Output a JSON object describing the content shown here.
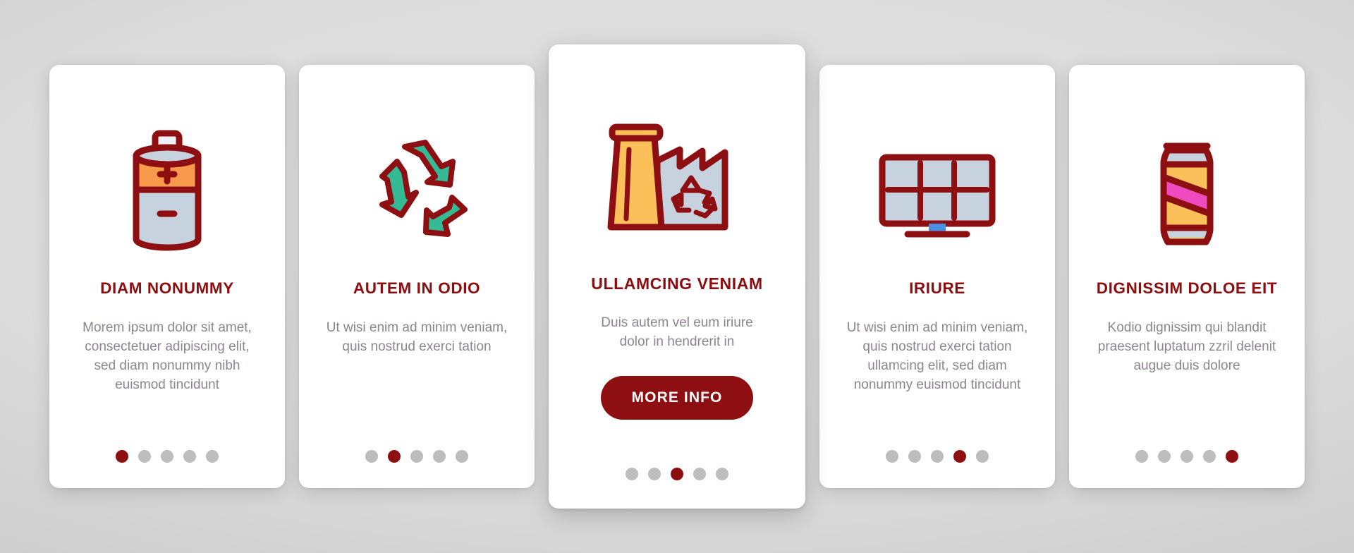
{
  "theme": {
    "background": "#dcdcdc",
    "card_background": "#ffffff",
    "accent_red": "#8e0f11",
    "body_text": "#8d8490",
    "dot_inactive": "#bdbdbd",
    "icon_orange": "#f79a4b",
    "icon_yellow": "#fbc05a",
    "icon_grayblue": "#c6d2de",
    "icon_green": "#34ba94",
    "icon_pink": "#ef4ac0",
    "icon_blue": "#4a90e2"
  },
  "cards": [
    {
      "id": "card-1",
      "icon": "battery-icon",
      "title": "DIAM NONUMMY",
      "body": "Morem ipsum dolor sit amet, consectetuer adipiscing elit, sed diam nonummy nibh euismod tincidunt",
      "featured": false,
      "button": null,
      "dots": {
        "count": 5,
        "active_index": 0
      }
    },
    {
      "id": "card-2",
      "icon": "recycle-arrows-icon",
      "title": "AUTEM IN ODIO",
      "body": "Ut wisi enim ad minim veniam, quis nostrud exerci tation",
      "featured": false,
      "button": null,
      "dots": {
        "count": 5,
        "active_index": 1
      }
    },
    {
      "id": "card-3",
      "icon": "recycling-factory-icon",
      "title": "ULLAMCING VENIAM",
      "body": "Duis autem vel eum iriure dolor in hendrerit in",
      "featured": true,
      "button": "MORE INFO",
      "dots": {
        "count": 5,
        "active_index": 2
      }
    },
    {
      "id": "card-4",
      "icon": "solar-panel-icon",
      "title": "IRIURE",
      "body": "Ut wisi enim ad minim veniam, quis nostrud exerci tation ullamcing elit, sed diam nonummy euismod tincidunt",
      "featured": false,
      "button": null,
      "dots": {
        "count": 5,
        "active_index": 3
      }
    },
    {
      "id": "card-5",
      "icon": "soda-can-icon",
      "title": "DIGNISSIM DOLOE EIT",
      "body": "Kodio dignissim qui blandit praesent luptatum zzril delenit augue duis dolore",
      "featured": false,
      "button": null,
      "dots": {
        "count": 5,
        "active_index": 4
      }
    }
  ]
}
